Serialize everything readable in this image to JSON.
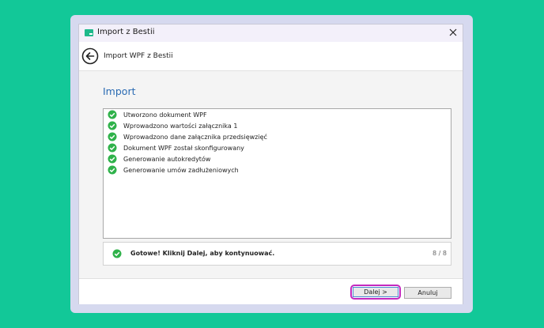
{
  "window": {
    "title": "Import z Bestii",
    "app_icon": "app-icon",
    "close_icon": "close-icon"
  },
  "header": {
    "back_icon": "arrow-left-circle-icon",
    "title": "Import WPF z Bestii"
  },
  "main": {
    "section_title": "Import",
    "log": [
      {
        "label": "Utworzono dokument WPF",
        "icon": "check-circle-icon"
      },
      {
        "label": "Wprowadzono wartości załącznika 1",
        "icon": "check-circle-icon"
      },
      {
        "label": "Wprowadzono dane załącznika przedsięwzięć",
        "icon": "check-circle-icon"
      },
      {
        "label": "Dokument WPF został skonfigurowany",
        "icon": "check-circle-icon"
      },
      {
        "label": "Generowanie autokredytów",
        "icon": "check-circle-icon"
      },
      {
        "label": "Generowanie umów zadłużeniowych",
        "icon": "check-circle-icon"
      }
    ],
    "status": {
      "text": "Gotowe! Kliknij Dalej, aby kontynuować.",
      "count": "8 / 8",
      "icon": "check-circle-icon"
    }
  },
  "footer": {
    "next_label": "Dalej >",
    "cancel_label": "Anuluj"
  },
  "colors": {
    "background": "#12c898",
    "accent_title": "#2b6bb3",
    "check_green": "#2fb24a",
    "highlight": "#c428be"
  }
}
